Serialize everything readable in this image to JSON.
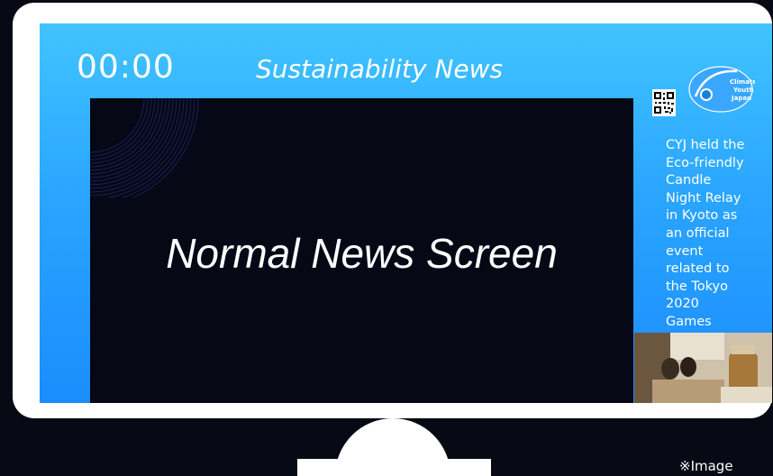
{
  "screen": {
    "clock": "00:00",
    "header_title": "Sustainability News",
    "main_caption": "Normal News Screen",
    "side_news": "CYJ held the Eco-friendly Candle Night Relay in Kyoto as an official event related to the Tokyo 2020 Games",
    "logo_text": {
      "line1": "Climate",
      "line2": "Youth",
      "line3": "Japan"
    },
    "icons": [
      "qr-code-icon",
      "climate-youth-japan-logo"
    ]
  },
  "footnote": "※Image",
  "colors": {
    "background": "#070914",
    "screen_gradient_top": "#41c4ff",
    "screen_gradient_bottom": "#1a8dfc",
    "main_panel": "#070816",
    "frame": "#ffffff"
  }
}
